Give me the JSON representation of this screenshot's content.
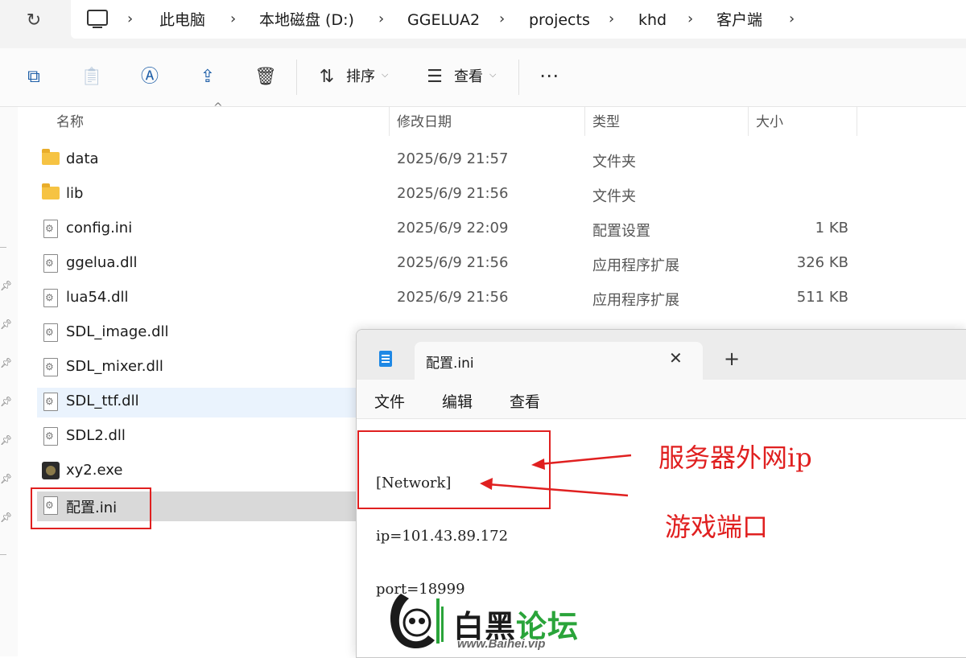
{
  "addressbar": {
    "breadcrumbs": [
      "此电脑",
      "本地磁盘 (D:)",
      "GGELUA2",
      "projects",
      "khd",
      "客户端"
    ]
  },
  "toolbar": {
    "sort_label": "排序",
    "view_label": "查看"
  },
  "columns": {
    "name": "名称",
    "date": "修改日期",
    "type": "类型",
    "size": "大小"
  },
  "files": [
    {
      "name": "data",
      "date": "2025/6/9 21:57",
      "type": "文件夹",
      "size": "",
      "icon": "folder-icon"
    },
    {
      "name": "lib",
      "date": "2025/6/9 21:56",
      "type": "文件夹",
      "size": "",
      "icon": "folder-icon"
    },
    {
      "name": "config.ini",
      "date": "2025/6/9 22:09",
      "type": "配置设置",
      "size": "1 KB",
      "icon": "ini-file-icon"
    },
    {
      "name": "ggelua.dll",
      "date": "2025/6/9 21:56",
      "type": "应用程序扩展",
      "size": "326 KB",
      "icon": "dll-file-icon"
    },
    {
      "name": "lua54.dll",
      "date": "2025/6/9 21:56",
      "type": "应用程序扩展",
      "size": "511 KB",
      "icon": "dll-file-icon"
    },
    {
      "name": "SDL_image.dll",
      "date": "",
      "type": "",
      "size": "",
      "icon": "dll-file-icon"
    },
    {
      "name": "SDL_mixer.dll",
      "date": "",
      "type": "",
      "size": "",
      "icon": "dll-file-icon"
    },
    {
      "name": "SDL_ttf.dll",
      "date": "",
      "type": "",
      "size": "",
      "icon": "dll-file-icon"
    },
    {
      "name": "SDL2.dll",
      "date": "",
      "type": "",
      "size": "",
      "icon": "dll-file-icon"
    },
    {
      "name": "xy2.exe",
      "date": "",
      "type": "",
      "size": "",
      "icon": "exe-file-icon"
    },
    {
      "name": "配置.ini",
      "date": "",
      "type": "",
      "size": "",
      "icon": "ini-file-icon"
    }
  ],
  "notepad": {
    "tab_title": "配置.ini",
    "menu": [
      "文件",
      "编辑",
      "查看"
    ],
    "content": [
      "[Network]",
      "ip=101.43.89.172",
      "port=18999"
    ]
  },
  "annotations": {
    "ip_note": "服务器外网ip",
    "port_note": "游戏端口",
    "color": "#e02020"
  },
  "watermark": {
    "title_black": "白黑",
    "title_green": "论坛",
    "url": "www.Baihei.vip"
  }
}
